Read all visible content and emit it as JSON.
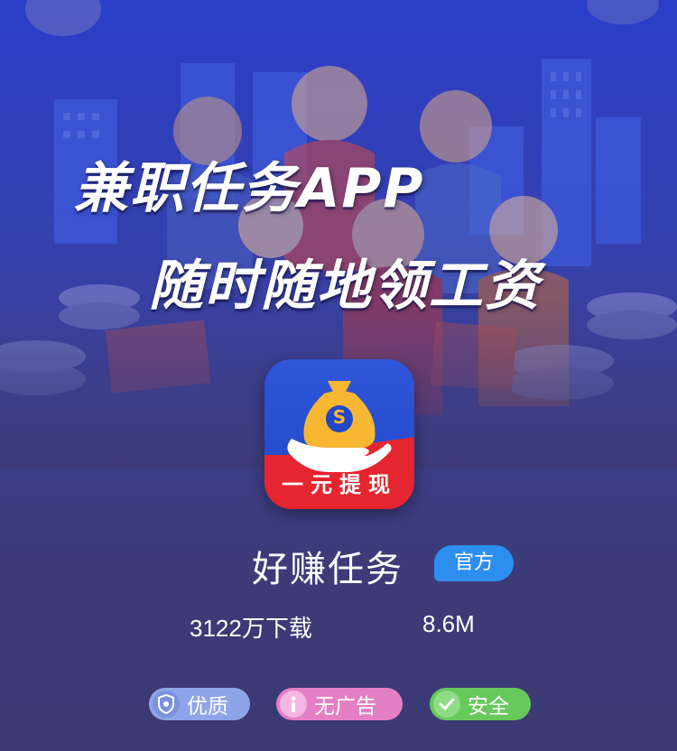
{
  "hero": {
    "headline_line1": "兼职任务APP",
    "headline_line2": "随时随地领工资"
  },
  "app": {
    "icon_label": "一元提现",
    "icon_symbol": "S",
    "name": "好赚任务",
    "official_badge": "官方",
    "downloads": "3122万下载",
    "size": "8.6M"
  },
  "badges": [
    {
      "label": "优质",
      "icon": "shield-icon",
      "color": "#8fa4e8"
    },
    {
      "label": "无广告",
      "icon": "info-icon",
      "color": "#e57fc4"
    },
    {
      "label": "安全",
      "icon": "check-icon",
      "color": "#67c85b"
    }
  ],
  "colors": {
    "background": "#3c3a72",
    "hero_blue": "#2a3ec9",
    "icon_blue": "#2247c9",
    "icon_red": "#e5252f",
    "official_blue": "#2e8ef0"
  }
}
